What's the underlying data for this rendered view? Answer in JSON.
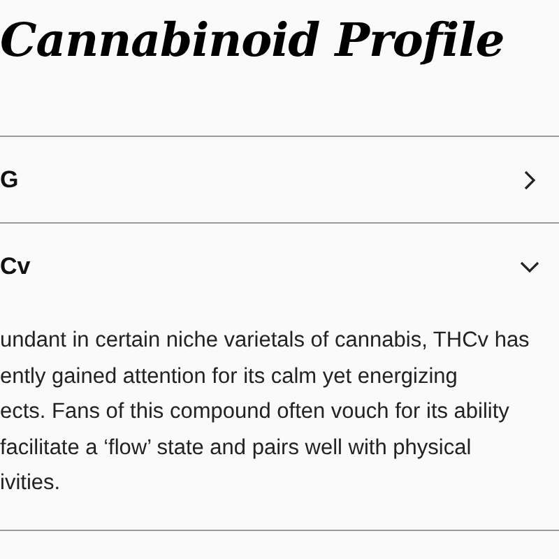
{
  "title": "Cannabinoid Profile",
  "accordion": [
    {
      "label": "G",
      "expanded": false
    },
    {
      "label": "Cv",
      "expanded": true,
      "body_lines": [
        "undant in certain niche varietals of cannabis, THCv has",
        "ently gained attention for its calm yet energizing",
        "ects. Fans of this compound often vouch for its ability",
        "facilitate a ‘flow’ state and pairs well with physical",
        "ivities."
      ]
    }
  ]
}
